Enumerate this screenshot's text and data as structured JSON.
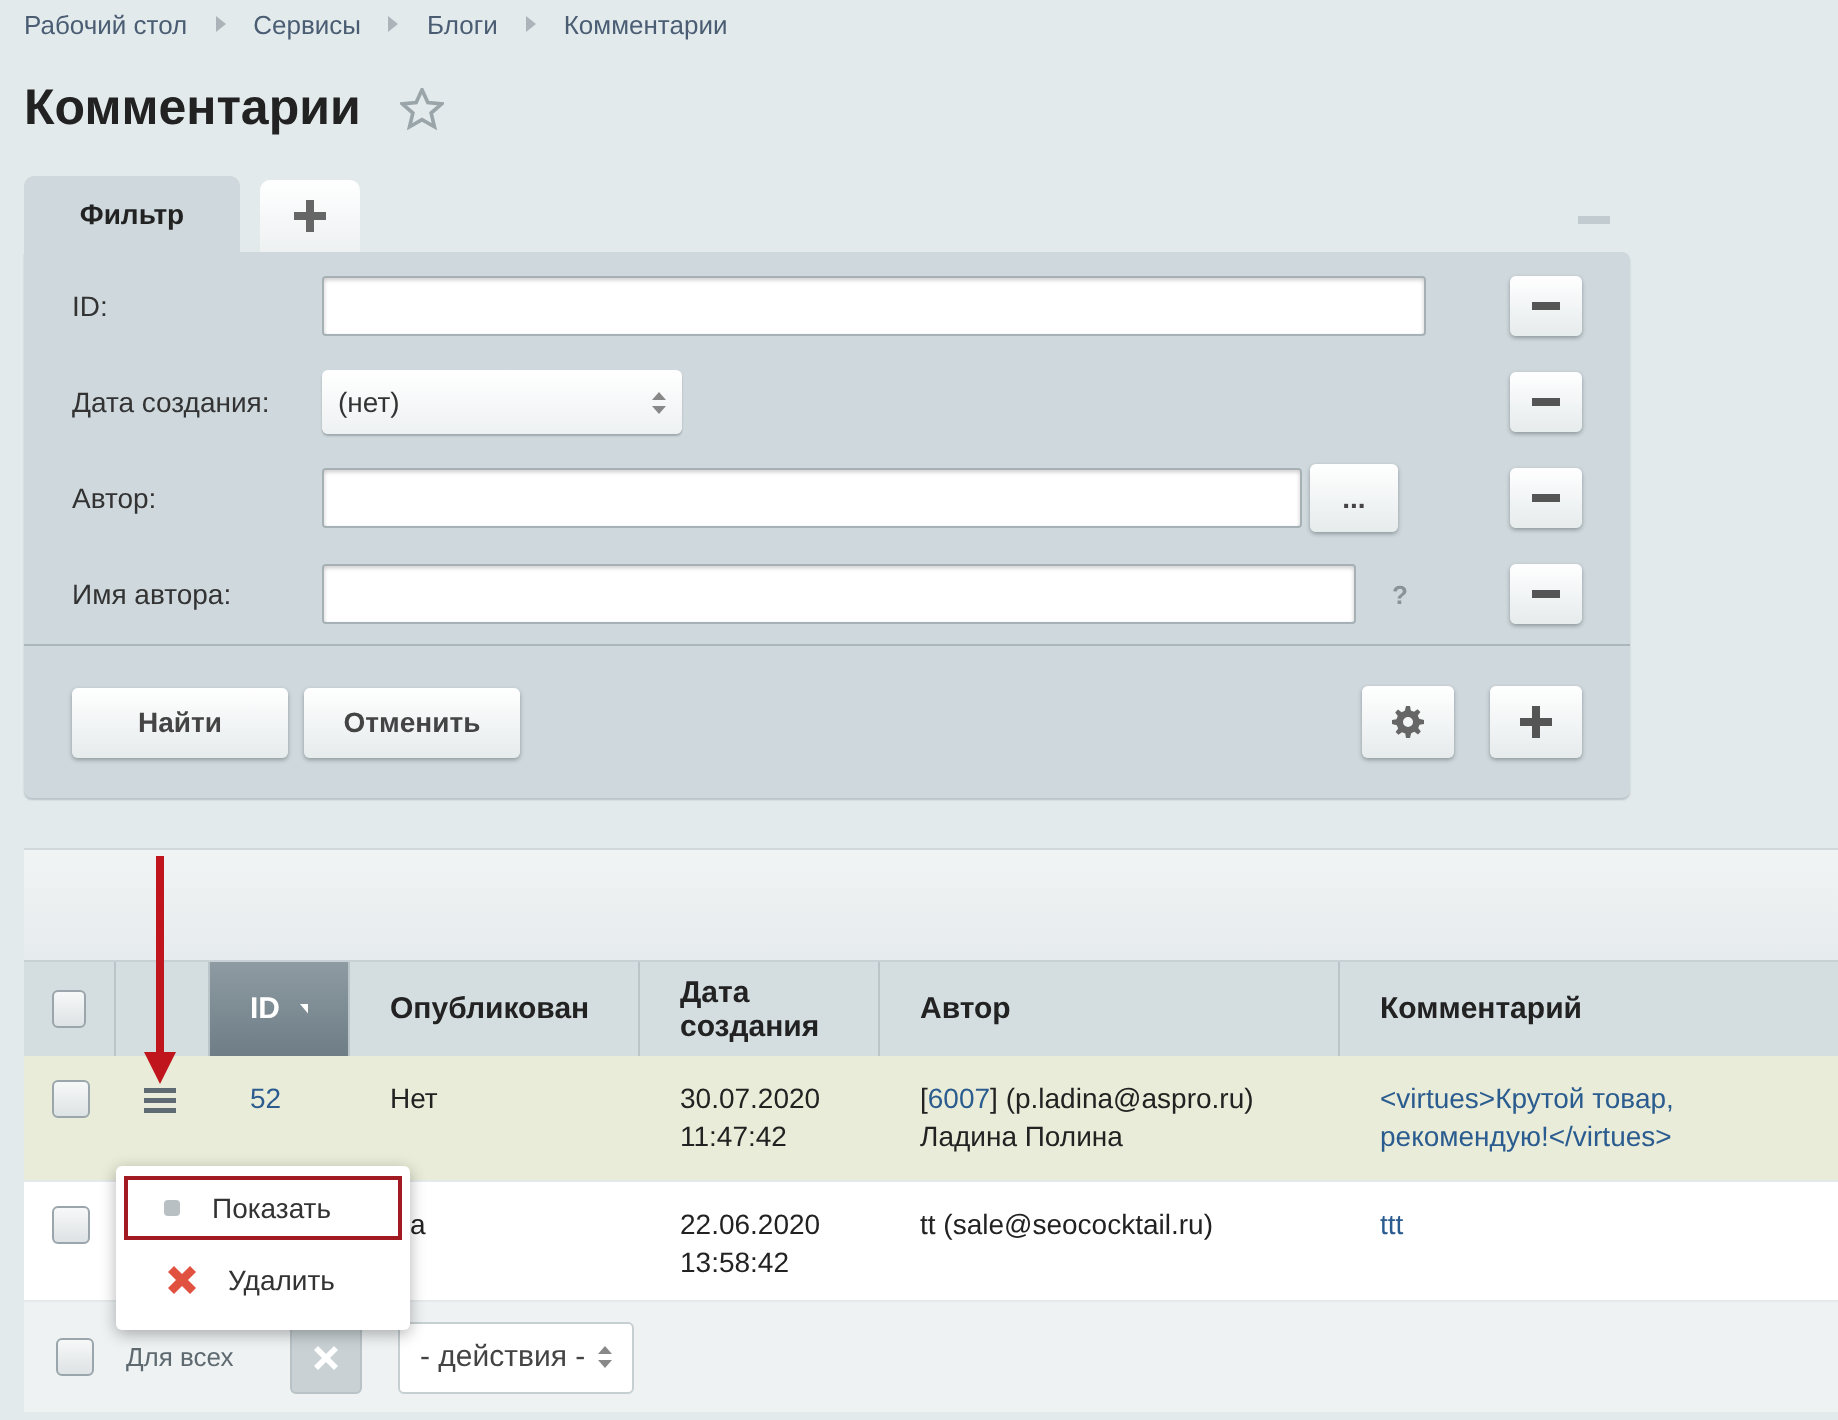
{
  "breadcrumbs": [
    "Рабочий стол",
    "Сервисы",
    "Блоги",
    "Комментарии"
  ],
  "title": "Комментарии",
  "favorite": false,
  "filter": {
    "tabs": [
      {
        "label": "Фильтр",
        "selected": true
      }
    ],
    "fields": [
      {
        "label": "ID:",
        "kind": "text"
      },
      {
        "label": "Дата создания:",
        "kind": "select",
        "value": "(нет)"
      },
      {
        "label": "Автор:",
        "kind": "picker",
        "button": "..."
      },
      {
        "label": "Имя автора:",
        "kind": "help",
        "help": "?"
      }
    ],
    "buttons": [
      "Найти",
      "Отменить"
    ]
  },
  "table": {
    "all_checked": false,
    "columns": [
      {
        "label": "ID",
        "sorted": true
      },
      {
        "label": "Опубликован",
        "sorted": false
      },
      {
        "label": "Дата создания",
        "sorted": false
      },
      {
        "label": "Автор",
        "sorted": false
      },
      {
        "label": "Комментарий",
        "sorted": false
      }
    ],
    "rows": [
      {
        "checked": false,
        "highlighted": true,
        "id": "52",
        "published": "Нет",
        "date": "30.07.2020",
        "time": "11:47:42",
        "author_before": "[",
        "author_link": "6007",
        "author_after": "] (p.ladina@aspro.ru)",
        "author_name": "Ладина Полина",
        "comment": "<virtues>Крутой товар, рекомендую!</virtues>"
      },
      {
        "checked": false,
        "highlighted": false,
        "id": "",
        "published": "а",
        "date": "22.06.2020",
        "time": "13:58:42",
        "author_after": "tt (sale@seococktail.ru)",
        "comment": "ttt"
      }
    ],
    "footer": {
      "checked": false,
      "label": "Для всех",
      "action": "- действия -"
    }
  },
  "context_menu": {
    "items": [
      {
        "label": "Показать",
        "kind": "show",
        "selected": true
      },
      {
        "label": "Удалить",
        "kind": "delete",
        "selected": false
      }
    ]
  }
}
